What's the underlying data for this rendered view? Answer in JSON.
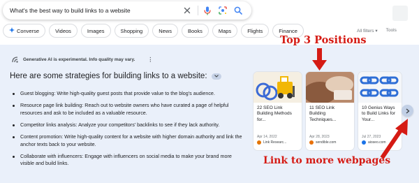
{
  "search": {
    "query": "What's the best way to build links to a website",
    "icons": [
      "close-icon",
      "mic-icon",
      "lens-icon",
      "search-icon"
    ]
  },
  "chips": [
    {
      "label": "Converse",
      "icon": "sparkle-icon"
    },
    {
      "label": "Videos"
    },
    {
      "label": "Images"
    },
    {
      "label": "Shopping"
    },
    {
      "label": "News"
    },
    {
      "label": "Books"
    },
    {
      "label": "Maps"
    },
    {
      "label": "Flights"
    },
    {
      "label": "Finance"
    }
  ],
  "filters": {
    "all_filters": "All filters ▾",
    "tools": "Tools"
  },
  "sge": {
    "notice": "Generative AI is experimental. Info quality may vary.",
    "heading": "Here are some strategies for building links to a website:",
    "items": [
      "Guest blogging: Write high-quality guest posts that provide value to the blog's audience.",
      "Resource page link building: Reach out to website owners who have curated a page of helpful resources and ask to be included as a valuable resource.",
      "Competitor links analysis: Analyze your competitors' backlinks to see if they lack authority.",
      "Content promotion: Write high-quality content for a website with higher domain authority and link the anchor texts back to your website.",
      "Collaborate with influencers: Engage with influencers on social media to make your brand more visible and build links."
    ],
    "cards": [
      {
        "title": "22 SEO Link Building Methods for...",
        "date": "Apr 14, 2022",
        "source": "Link Researc...",
        "fav_color": "#e37400"
      },
      {
        "title": "11 SEO Link Building Techniques...",
        "date": "Apr 28, 2023",
        "source": "sendible.com",
        "fav_color": "#e8710a"
      },
      {
        "title": "10 Genius Ways to Build Links for Your...",
        "date": "Jul 27, 2023",
        "source": "aioseo.com",
        "fav_color": "#1a73e8"
      }
    ]
  },
  "annotations": {
    "top_positions": "Top 3 Positions",
    "more_webpages": "Link to more webpages"
  },
  "colors": {
    "accent": "#1a73e8",
    "sge_background": "#eaf0fa",
    "annotation_red": "#d51b14"
  }
}
